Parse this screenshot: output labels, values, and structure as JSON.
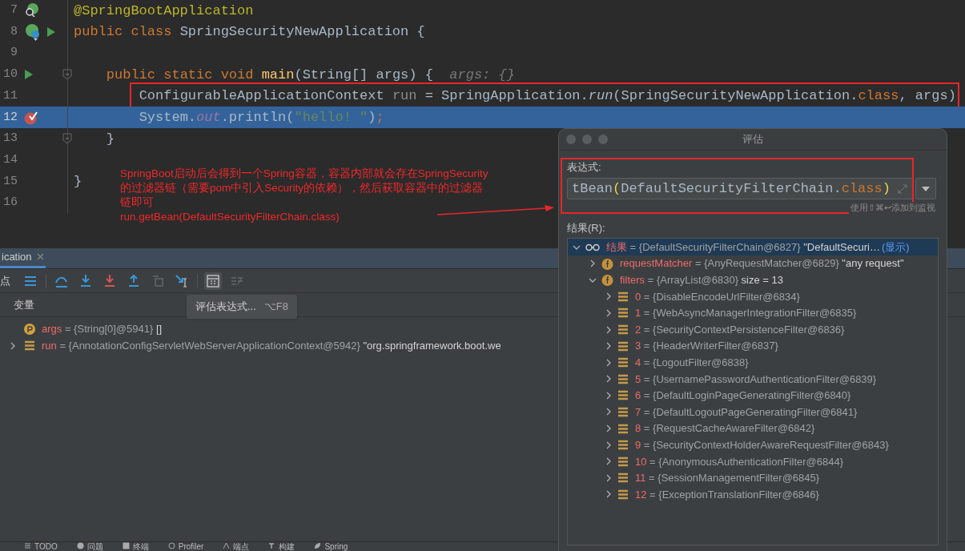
{
  "editor": {
    "lines": [
      {
        "number": "7",
        "gutter": [
          {
            "kind": "bean-search"
          }
        ],
        "fold": false,
        "current": false,
        "segments": [
          {
            "kind": "annotation",
            "text": "@SpringBootApplication"
          }
        ]
      },
      {
        "number": "8",
        "gutter": [
          {
            "kind": "bean"
          },
          {
            "kind": "run"
          }
        ],
        "fold": false,
        "current": false,
        "segments": [
          {
            "kind": "keyword",
            "text": "public class "
          },
          {
            "kind": "plain",
            "text": "SpringSecurityNewApplication {"
          }
        ]
      },
      {
        "number": "9",
        "fold": false,
        "current": false
      },
      {
        "number": "10",
        "gutter": [
          {
            "kind": "run"
          }
        ],
        "fold": true,
        "current": false,
        "segments": [
          {
            "kind": "keyword",
            "text": "    public static void "
          },
          {
            "kind": "method",
            "text": "main"
          },
          {
            "kind": "plain",
            "text": "(String[] args) {  "
          },
          {
            "kind": "hint",
            "text": "args: {}"
          }
        ]
      },
      {
        "number": "11",
        "fold": false,
        "current": false,
        "segments": [
          {
            "kind": "plain",
            "text": "        ConfigurableApplicationContext "
          },
          {
            "kind": "muted",
            "text": "run"
          },
          {
            "kind": "plain",
            "text": " = SpringApplication."
          },
          {
            "kind": "italic",
            "text": "run"
          },
          {
            "kind": "plain",
            "text": "(SpringSecurityNewApplication."
          },
          {
            "kind": "keyword",
            "text": "class"
          },
          {
            "kind": "plain",
            "text": ", args)"
          }
        ]
      },
      {
        "number": "12",
        "gutter": [
          {
            "kind": "breakpoint"
          }
        ],
        "fold": false,
        "current": true,
        "segments": [
          {
            "kind": "plain",
            "text": "        System."
          },
          {
            "kind": "static",
            "text": "out"
          },
          {
            "kind": "plain",
            "text": ".println("
          },
          {
            "kind": "string",
            "text": "\"hello! \""
          },
          {
            "kind": "plain",
            "text": ")"
          },
          {
            "kind": "keyword",
            "text": ";"
          }
        ]
      },
      {
        "number": "13",
        "fold": true,
        "current": false,
        "segments": [
          {
            "kind": "plain",
            "text": "    }"
          }
        ]
      },
      {
        "number": "14",
        "fold": false,
        "current": false
      },
      {
        "number": "15",
        "fold": false,
        "current": false,
        "segments": [
          {
            "kind": "plain",
            "text": "}"
          }
        ]
      },
      {
        "number": "16",
        "fold": false,
        "current": false
      }
    ]
  },
  "annotation": {
    "lines": [
      "SpringBoot启动后会得到一个Spring容器，容器内部就会存在SpringSecurity",
      "的过滤器链（需要pom中引入Security的依赖），然后获取容器中的过滤器",
      "链即可",
      "run.getBean(DefaultSecurityFilterChain.class)"
    ]
  },
  "debug_panel": {
    "tab": {
      "label": "ication",
      "selected": true
    },
    "toolbar": {
      "cut_label": "点",
      "evaluate_hovered": true
    },
    "tooltip": {
      "text": "评估表达式...",
      "shortcut": "⌥F8"
    },
    "variables_header": "变量",
    "variables": [
      {
        "kind": "param",
        "name": "args",
        "value": "= {String[0]@5941}",
        "extra": "[]",
        "expandable": false
      },
      {
        "kind": "local",
        "name": "run",
        "value": "= {AnnotationConfigServletWebServerApplicationContext@5942}",
        "extra": "\"org.springframework.boot.we",
        "expandable": true
      }
    ]
  },
  "evaluate_dialog": {
    "title": "评估",
    "expression_label": "表达式:",
    "expression": [
      {
        "kind": "plain",
        "text": "tBean"
      },
      {
        "kind": "paren",
        "text": "("
      },
      {
        "kind": "plain",
        "text": "DefaultSecurityFilterChain."
      },
      {
        "kind": "keyword",
        "text": "class"
      },
      {
        "kind": "paren",
        "text": ")"
      }
    ],
    "hint": "使用⇧⌘↩添加到监视",
    "result_label": "结果(R):",
    "result": [
      {
        "kind": "watch",
        "name": "结果",
        "value": "= {DefaultSecurityFilterChain@6827}",
        "extra": "\"DefaultSecuri…",
        "link": "(显示)",
        "expanded": true,
        "selected": true,
        "children": [
          {
            "kind": "field",
            "name": "requestMatcher",
            "value": "= {AnyRequestMatcher@6829}",
            "extra": "\"any request\"",
            "expanded": false,
            "selected": false
          },
          {
            "kind": "field",
            "name": "filters",
            "value": "= {ArrayList@6830}",
            "extra": "size = 13",
            "expanded": true,
            "selected": false,
            "children": [
              {
                "kind": "element",
                "name": "0",
                "value": "= {DisableEncodeUrlFilter@6834}",
                "expanded": false,
                "selected": false
              },
              {
                "kind": "element",
                "name": "1",
                "value": "= {WebAsyncManagerIntegrationFilter@6835}",
                "expanded": false,
                "selected": false
              },
              {
                "kind": "element",
                "name": "2",
                "value": "= {SecurityContextPersistenceFilter@6836}",
                "expanded": false,
                "selected": false
              },
              {
                "kind": "element",
                "name": "3",
                "value": "= {HeaderWriterFilter@6837}",
                "expanded": false,
                "selected": false
              },
              {
                "kind": "element",
                "name": "4",
                "value": "= {LogoutFilter@6838}",
                "expanded": false,
                "selected": false
              },
              {
                "kind": "element",
                "name": "5",
                "value": "= {UsernamePasswordAuthenticationFilter@6839}",
                "expanded": false,
                "selected": false
              },
              {
                "kind": "element",
                "name": "6",
                "value": "= {DefaultLoginPageGeneratingFilter@6840}",
                "expanded": false,
                "selected": false
              },
              {
                "kind": "element",
                "name": "7",
                "value": "= {DefaultLogoutPageGeneratingFilter@6841}",
                "expanded": false,
                "selected": false
              },
              {
                "kind": "element",
                "name": "8",
                "value": "= {RequestCacheAwareFilter@6842}",
                "expanded": false,
                "selected": false
              },
              {
                "kind": "element",
                "name": "9",
                "value": "= {SecurityContextHolderAwareRequestFilter@6843}",
                "expanded": false,
                "selected": false
              },
              {
                "kind": "element",
                "name": "10",
                "value": "= {AnonymousAuthenticationFilter@6844}",
                "expanded": false,
                "selected": false
              },
              {
                "kind": "element",
                "name": "11",
                "value": "= {SessionManagementFilter@6845}",
                "expanded": false,
                "selected": false
              },
              {
                "kind": "element",
                "name": "12",
                "value": "= {ExceptionTranslationFilter@6846}",
                "expanded": false,
                "selected": false
              }
            ]
          }
        ]
      }
    ]
  },
  "status_bar": {
    "tools": [
      {
        "kind": "list",
        "label": "TODO"
      },
      {
        "kind": "problems",
        "label": "问题"
      },
      {
        "kind": "terminal",
        "label": "终端"
      },
      {
        "kind": "profiler",
        "label": "Profiler"
      },
      {
        "kind": "endpoints",
        "label": "端点"
      },
      {
        "kind": "build",
        "label": "构建"
      },
      {
        "kind": "spring",
        "label": "Spring"
      }
    ]
  }
}
